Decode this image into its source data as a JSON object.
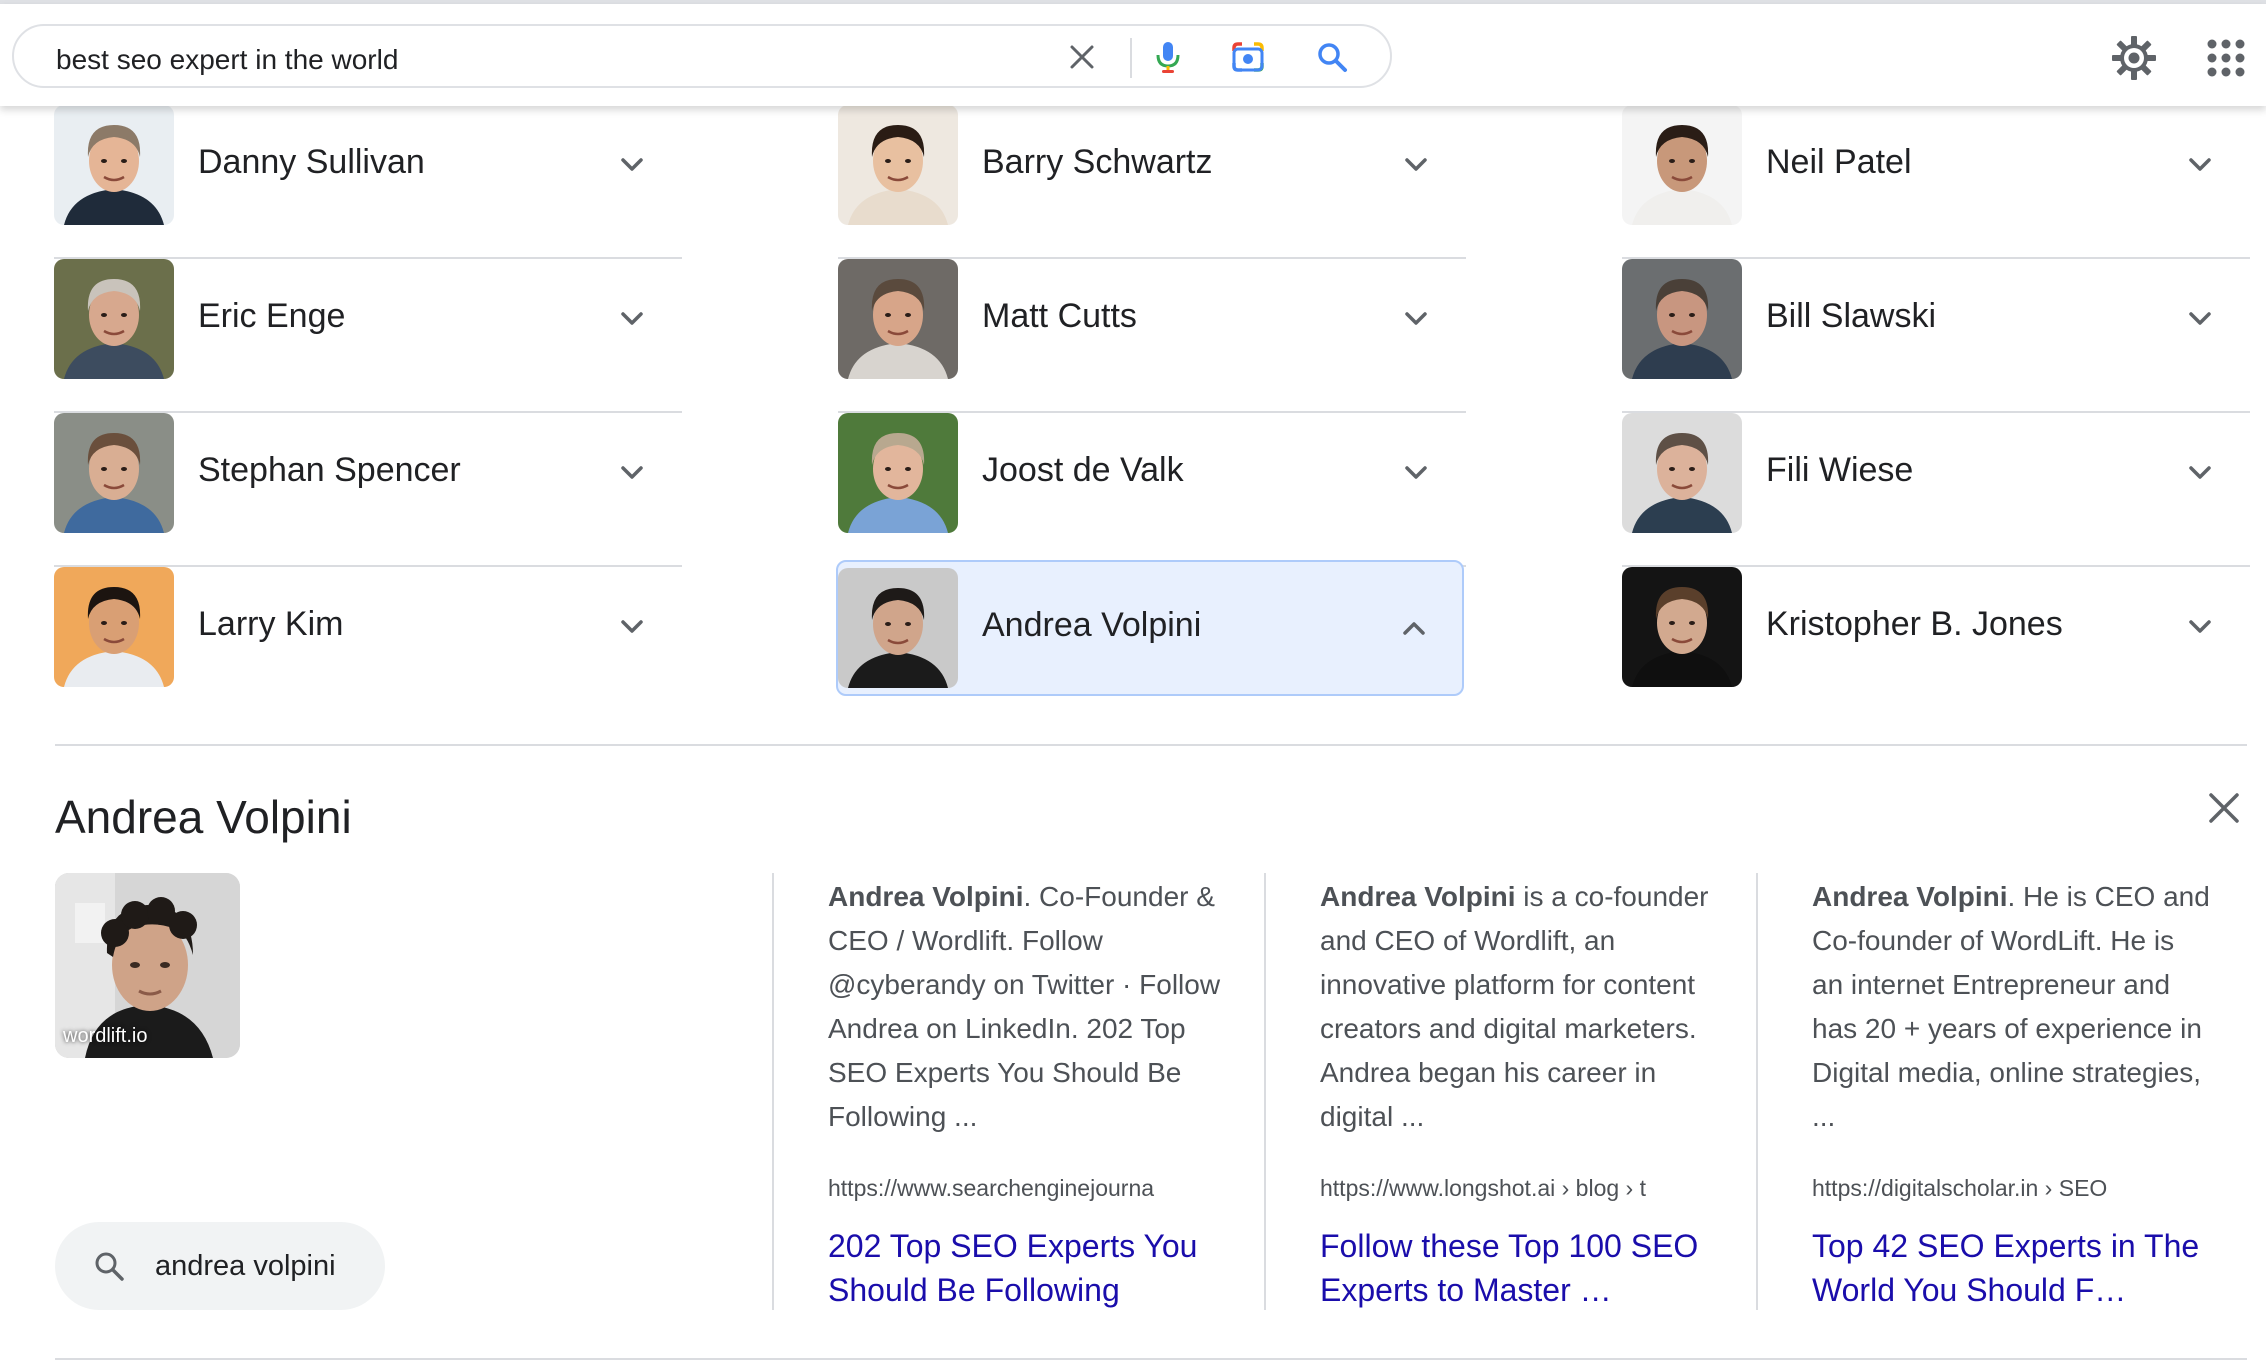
{
  "search": {
    "query": "best seo expert in the world",
    "icons": [
      "close-icon",
      "microphone-icon",
      "camera-lens-icon",
      "search-icon"
    ]
  },
  "header_icons": [
    "gear-icon",
    "apps-grid-icon"
  ],
  "people": [
    [
      {
        "name": "Danny Sullivan",
        "selected": false,
        "skin": "#e5b596",
        "hair": "#8c7a68",
        "bg": "#e9eef2",
        "shirt": "#1f2b3a"
      },
      {
        "name": "Eric Enge",
        "selected": false,
        "skin": "#d7a88e",
        "hair": "#c9c3bb",
        "bg": "#6b6f4b",
        "shirt": "#3d4c5f"
      },
      {
        "name": "Stephan Spencer",
        "selected": false,
        "skin": "#d9ae93",
        "hair": "#6a4f3c",
        "bg": "#8a8e87",
        "shirt": "#3f6a9e"
      },
      {
        "name": "Larry Kim",
        "selected": false,
        "skin": "#d99f74",
        "hair": "#1c1410",
        "bg": "#f0a85a",
        "shirt": "#e9ecf0"
      }
    ],
    [
      {
        "name": "Barry Schwartz",
        "selected": false,
        "skin": "#e8c0a0",
        "hair": "#2a1c14",
        "bg": "#eee8e0",
        "shirt": "#e8dccd"
      },
      {
        "name": "Matt Cutts",
        "selected": false,
        "skin": "#d7a589",
        "hair": "#5a4a3d",
        "bg": "#6e6a66",
        "shirt": "#d8d4cf"
      },
      {
        "name": "Joost de Valk",
        "selected": false,
        "skin": "#e2b69c",
        "hair": "#b8a88f",
        "bg": "#4f7a3b",
        "shirt": "#7aa3d6"
      },
      {
        "name": "Andrea Volpini",
        "selected": true,
        "skin": "#d0a58b",
        "hair": "#1e1a18",
        "bg": "#c9c9c9",
        "shirt": "#1b1b1b"
      }
    ],
    [
      {
        "name": "Neil Patel",
        "selected": false,
        "skin": "#c8987a",
        "hair": "#2a1d16",
        "bg": "#f4f4f4",
        "shirt": "#f0efed"
      },
      {
        "name": "Bill Slawski",
        "selected": false,
        "skin": "#c89680",
        "hair": "#4a4038",
        "bg": "#6b6e70",
        "shirt": "#2e3d4f"
      },
      {
        "name": "Fili Wiese",
        "selected": false,
        "skin": "#dcb29b",
        "hair": "#5e5046",
        "bg": "#dcdcdc",
        "shirt": "#2c3e50"
      },
      {
        "name": "Kristopher B. Jones",
        "selected": false,
        "skin": "#d2a98f",
        "hair": "#5a3f2b",
        "bg": "#141414",
        "shirt": "#0f0f0f"
      }
    ]
  ],
  "detail": {
    "title": "Andrea Volpini",
    "photo_source": "wordlift.io",
    "related_search": "andrea volpini",
    "results": [
      {
        "snippet_name": "Andrea Volpini",
        "snippet_rest": ". Co-Founder & CEO / Wordlift. Follow @cyberandy on Twitter · Follow Andrea on LinkedIn. 202 Top SEO Experts You Should Be Following ...",
        "url": "https://www.searchenginejourna",
        "title": "202 Top SEO Experts You Should Be Following"
      },
      {
        "snippet_name": "Andrea Volpini",
        "snippet_rest": " is a co-founder and CEO of Wordlift, an innovative platform for content creators and digital marketers. Andrea began his career in digital ...",
        "url": "https://www.longshot.ai › blog › t",
        "title": "Follow these Top 100 SEO Experts to Master …"
      },
      {
        "snippet_name": "Andrea Volpini",
        "snippet_rest": ". He is CEO and Co-founder of WordLift. He is an internet Entrepreneur and has 20 + years of experience in Digital media, online strategies, ...",
        "url": "https://digitalscholar.in › SEO",
        "title": "Top 42 SEO Experts in The World You Should F…"
      }
    ]
  },
  "colors": {
    "link": "#1a0dab",
    "selected_bg": "#e8f0fe",
    "selected_border": "#aecbfa",
    "divider": "#dadce0"
  }
}
